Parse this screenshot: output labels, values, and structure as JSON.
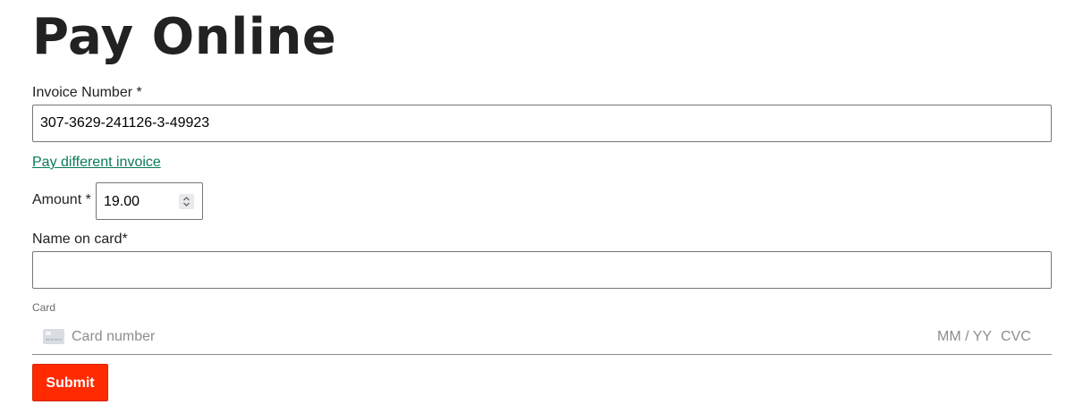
{
  "page_title": "Pay Online",
  "invoice": {
    "label": "Invoice Number *",
    "value": "307-3629-241126-3-49923"
  },
  "different_invoice_link": "Pay different invoice",
  "amount": {
    "label": "Amount *",
    "value": "19.00"
  },
  "name_on_card": {
    "label": "Name on card*",
    "value": ""
  },
  "card": {
    "label": "Card",
    "number_placeholder": "Card number",
    "expiry_placeholder": "MM / YY",
    "cvc_placeholder": "CVC",
    "icon": "credit-card-icon"
  },
  "submit_label": "Submit",
  "colors": {
    "link": "#0a7a5a",
    "submit_bg": "#ff2a00",
    "text": "#222222",
    "placeholder": "#8d8d8d"
  }
}
